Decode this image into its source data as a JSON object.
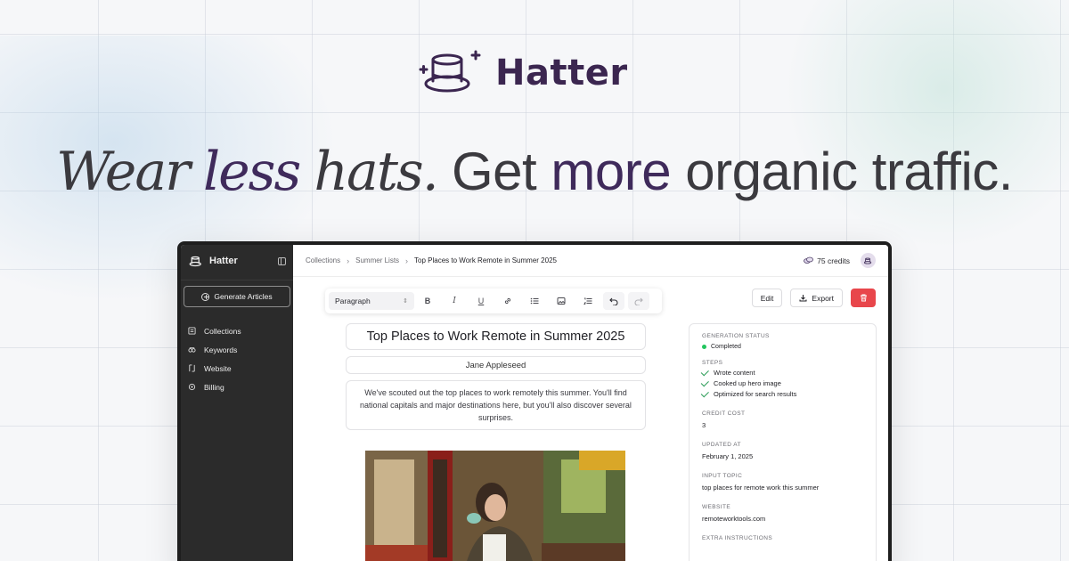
{
  "brand": {
    "name": "Hatter"
  },
  "headline": {
    "part1": "Wear",
    "part2": "less",
    "part3": "hats.",
    "part4": "Get",
    "part5": "more",
    "part6": "organic traffic."
  },
  "sidebar": {
    "brand": "Hatter",
    "generate_label": "Generate Articles",
    "items": [
      {
        "label": "Collections",
        "icon": "collections-icon"
      },
      {
        "label": "Keywords",
        "icon": "keywords-icon"
      },
      {
        "label": "Website",
        "icon": "website-icon"
      },
      {
        "label": "Billing",
        "icon": "billing-icon"
      }
    ]
  },
  "topbar": {
    "breadcrumbs": [
      "Collections",
      "Summer Lists",
      "Top Places to Work Remote in Summer 2025"
    ],
    "credits": "75 credits"
  },
  "toolbar": {
    "block_type": "Paragraph",
    "bold": "B",
    "italic": "I",
    "underline": "U"
  },
  "actions": {
    "edit": "Edit",
    "export": "Export"
  },
  "article": {
    "title": "Top Places to Work Remote in Summer 2025",
    "author": "Jane Appleseed",
    "summary": "We've scouted out the top places to work remotely this summer. You'll find national capitals and major destinations here, but you'll also discover several surprises."
  },
  "panel": {
    "status_label": "GENERATION STATUS",
    "status_value": "Completed",
    "steps_label": "STEPS",
    "steps": [
      "Wrote content",
      "Cooked up hero image",
      "Optimized for search results"
    ],
    "cost_label": "CREDIT COST",
    "cost_value": "3",
    "updated_label": "UPDATED AT",
    "updated_value": "February 1, 2025",
    "topic_label": "INPUT TOPIC",
    "topic_value": "top places for remote work this summer",
    "website_label": "WEBSITE",
    "website_value": "remoteworktools.com",
    "extra_label": "EXTRA INSTRUCTIONS"
  },
  "colors": {
    "accent": "#3f2a5b",
    "danger": "#e8464b",
    "success": "#22c55e",
    "sidebar": "#2b2b2b"
  }
}
